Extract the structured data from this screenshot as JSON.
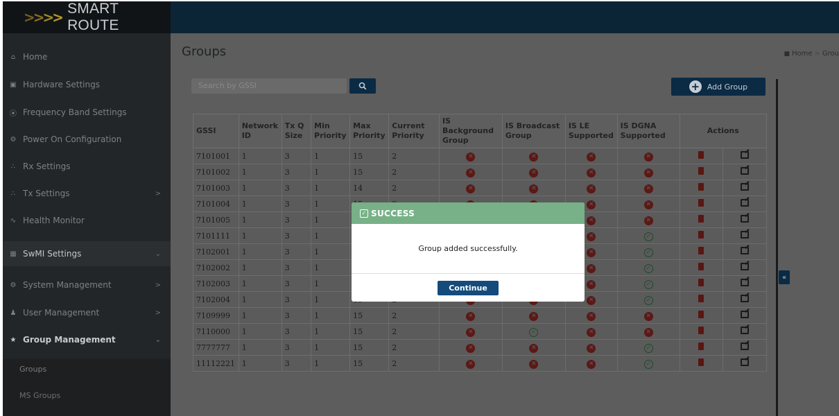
{
  "brand": {
    "name": "SMART ROUTE",
    "chevron_colors": [
      "#7a5d1e",
      "#8d6f1f",
      "#a58a25",
      "#b79a2c"
    ]
  },
  "sidebar": {
    "items": [
      {
        "label": "Home",
        "icon": "home-icon"
      },
      {
        "label": "Hardware Settings",
        "icon": "hardware-icon"
      },
      {
        "label": "Frequency Band Settings",
        "icon": "frequency-icon"
      },
      {
        "label": "Power On Configuration",
        "icon": "gear-icon"
      },
      {
        "label": "Rx Settings",
        "icon": "rx-icon"
      },
      {
        "label": "Tx Settings",
        "icon": "tx-icon"
      },
      {
        "label": "Health Monitor",
        "icon": "pulse-icon"
      },
      {
        "label": "SwMI Settings",
        "icon": "table-icon"
      },
      {
        "label": "System Management",
        "icon": "cogs-icon"
      },
      {
        "label": "User Management",
        "icon": "user-icon"
      },
      {
        "label": "Group Management",
        "icon": "group-icon"
      }
    ],
    "submenu": [
      {
        "label": "Groups"
      },
      {
        "label": "MS Groups"
      }
    ]
  },
  "page": {
    "title": "Groups",
    "breadcrumb": [
      "Home",
      "Grou"
    ],
    "search_placeholder": "Search by GSSI",
    "add_label": "Add Group"
  },
  "table": {
    "columns": [
      "GSSI",
      "Network ID",
      "Tx Q Size",
      "Min Priority",
      "Max Priority",
      "Current Priority",
      "IS Background Group",
      "IS Broadcast Group",
      "IS LE Supported",
      "IS DGNA Supported",
      "Actions"
    ],
    "rows": [
      {
        "gssi": "7101001",
        "network_id": "1",
        "txq": "3",
        "min": "1",
        "max": "15",
        "current": "2",
        "background": false,
        "broadcast": false,
        "le": false,
        "dgna": false
      },
      {
        "gssi": "7101002",
        "network_id": "1",
        "txq": "3",
        "min": "1",
        "max": "15",
        "current": "2",
        "background": false,
        "broadcast": false,
        "le": false,
        "dgna": false
      },
      {
        "gssi": "7101003",
        "network_id": "1",
        "txq": "3",
        "min": "1",
        "max": "14",
        "current": "2",
        "background": false,
        "broadcast": false,
        "le": false,
        "dgna": false
      },
      {
        "gssi": "7101004",
        "network_id": "1",
        "txq": "3",
        "min": "1",
        "max": "15",
        "current": "2",
        "background": false,
        "broadcast": false,
        "le": false,
        "dgna": false
      },
      {
        "gssi": "7101005",
        "network_id": "1",
        "txq": "3",
        "min": "1",
        "max": "15",
        "current": "2",
        "background": false,
        "broadcast": false,
        "le": false,
        "dgna": false
      },
      {
        "gssi": "7101111",
        "network_id": "1",
        "txq": "3",
        "min": "1",
        "max": "15",
        "current": "2",
        "background": false,
        "broadcast": false,
        "le": false,
        "dgna": true
      },
      {
        "gssi": "7102001",
        "network_id": "1",
        "txq": "3",
        "min": "1",
        "max": "15",
        "current": "2",
        "background": false,
        "broadcast": false,
        "le": false,
        "dgna": true
      },
      {
        "gssi": "7102002",
        "network_id": "1",
        "txq": "3",
        "min": "1",
        "max": "15",
        "current": "2",
        "background": false,
        "broadcast": false,
        "le": false,
        "dgna": true
      },
      {
        "gssi": "7102003",
        "network_id": "1",
        "txq": "3",
        "min": "1",
        "max": "15",
        "current": "2",
        "background": false,
        "broadcast": false,
        "le": false,
        "dgna": true
      },
      {
        "gssi": "7102004",
        "network_id": "1",
        "txq": "3",
        "min": "1",
        "max": "15",
        "current": "2",
        "background": false,
        "broadcast": false,
        "le": false,
        "dgna": true
      },
      {
        "gssi": "7109999",
        "network_id": "1",
        "txq": "3",
        "min": "1",
        "max": "15",
        "current": "2",
        "background": false,
        "broadcast": false,
        "le": false,
        "dgna": false
      },
      {
        "gssi": "7110000",
        "network_id": "1",
        "txq": "3",
        "min": "1",
        "max": "15",
        "current": "2",
        "background": false,
        "broadcast": true,
        "le": false,
        "dgna": false
      },
      {
        "gssi": "7777777",
        "network_id": "1",
        "txq": "3",
        "min": "1",
        "max": "15",
        "current": "2",
        "background": false,
        "broadcast": false,
        "le": false,
        "dgna": true
      },
      {
        "gssi": "11112221",
        "network_id": "1",
        "txq": "3",
        "min": "1",
        "max": "15",
        "current": "2",
        "background": false,
        "broadcast": false,
        "le": false,
        "dgna": true
      }
    ]
  },
  "modal": {
    "title": "SUCCESS",
    "message": "Group added successfully.",
    "button": "Continue",
    "header_color": "#78b188"
  }
}
